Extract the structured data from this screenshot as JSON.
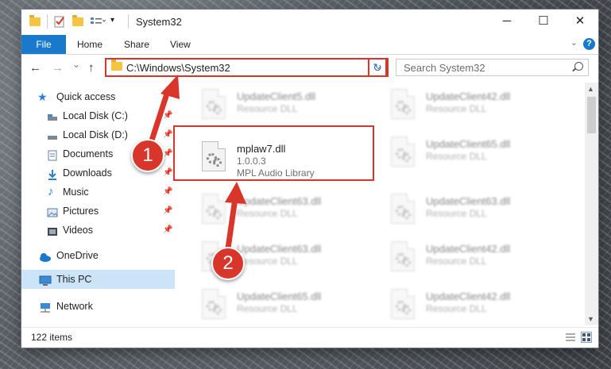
{
  "window": {
    "title": "System32",
    "controls": {
      "minimize": "─",
      "maximize": "☐",
      "close": "✕"
    }
  },
  "ribbon": {
    "file": "File",
    "tabs": [
      "Home",
      "Share",
      "View"
    ],
    "help": "?"
  },
  "nav": {
    "back": "←",
    "forward": "→",
    "recent": "⌄",
    "up": "↑",
    "address": "C:\\Windows\\System32",
    "address_dropdown": "⌄",
    "refresh": "↻",
    "search_placeholder": "Search System32"
  },
  "sidebar": {
    "items": [
      {
        "label": "Quick access",
        "icon": "star-icon"
      },
      {
        "label": "Local Disk (C:)",
        "icon": "drive-icon"
      },
      {
        "label": "Local Disk (D:)",
        "icon": "drive-icon"
      },
      {
        "label": "Documents",
        "icon": "documents-icon"
      },
      {
        "label": "Downloads",
        "icon": "download-icon"
      },
      {
        "label": "Music",
        "icon": "music-icon"
      },
      {
        "label": "Pictures",
        "icon": "pictures-icon"
      },
      {
        "label": "Videos",
        "icon": "videos-icon"
      },
      {
        "label": "OneDrive",
        "icon": "cloud-icon"
      },
      {
        "label": "This PC",
        "icon": "computer-icon"
      },
      {
        "label": "Network",
        "icon": "network-icon"
      }
    ],
    "pin_glyph": "📌"
  },
  "files": {
    "left": [
      {
        "name": "UpdateClient5.dll",
        "type": "Resource DLL"
      },
      {
        "name": "mplaw7.dll",
        "version": "1.0.0.3",
        "type": "MPL Audio Library"
      },
      {
        "name": "UpdateClient63.dll",
        "type": "Resource DLL"
      },
      {
        "name": "UpdateClient63.dll",
        "type": "Resource DLL"
      },
      {
        "name": "UpdateClient65.dll",
        "type": "Resource DLL"
      }
    ],
    "right": [
      {
        "name": "UpdateClient42.dll",
        "type": "Resource DLL"
      },
      {
        "name": "UpdateClient65.dll",
        "type": "Resource DLL"
      },
      {
        "name": "UpdateClient63.dll",
        "type": "Resource DLL"
      },
      {
        "name": "UpdateClient42.dll",
        "type": "Resource DLL"
      },
      {
        "name": "UpdateClient42.dll",
        "type": "Resource DLL"
      }
    ]
  },
  "status": {
    "items": "122 items"
  },
  "annotations": {
    "step1": "1",
    "step2": "2"
  },
  "colors": {
    "accent": "#1979ca",
    "callout": "#d9362b",
    "selected": "#cce4f7"
  }
}
